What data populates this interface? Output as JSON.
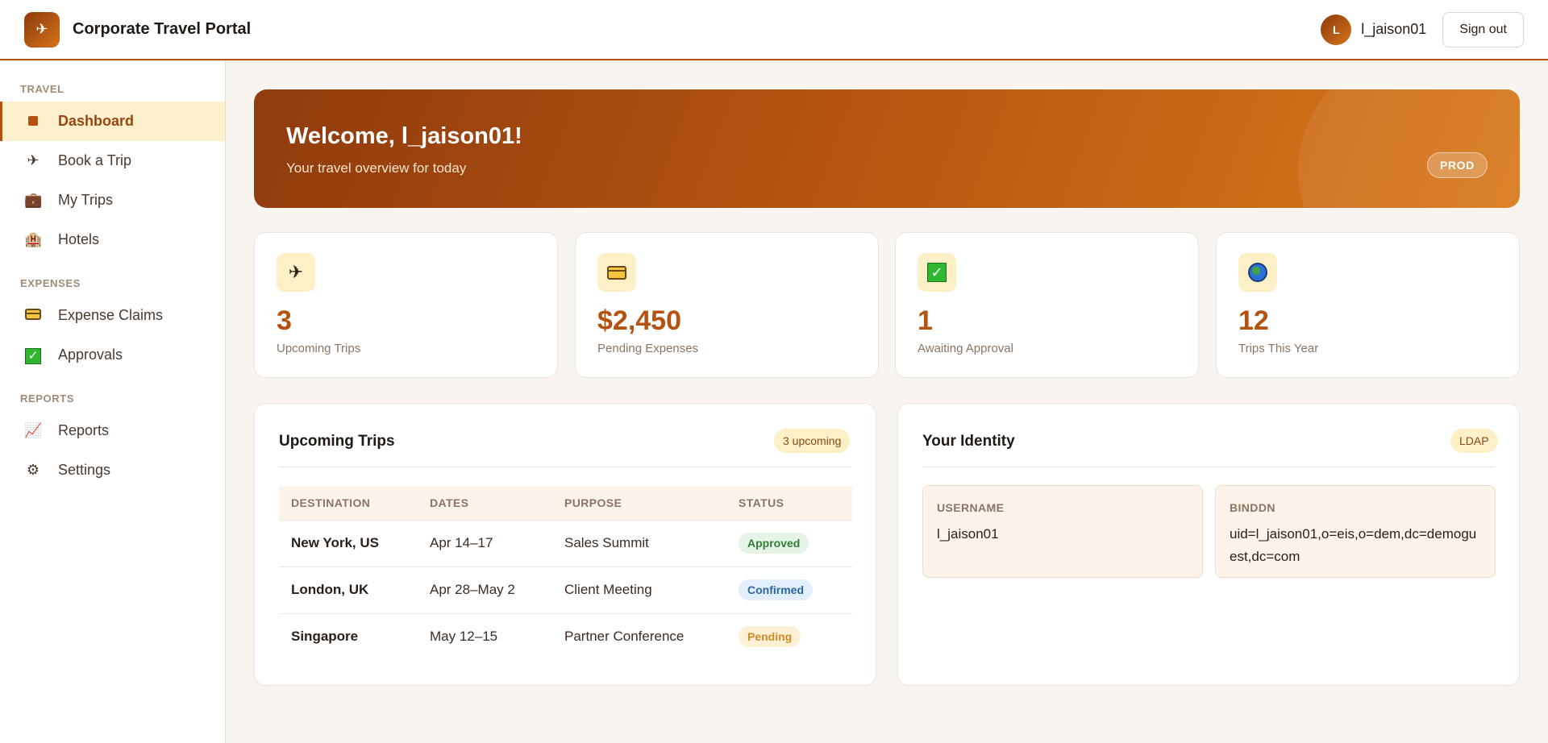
{
  "app": {
    "title": "Corporate Travel Portal",
    "logo_icon": "plane-icon"
  },
  "user": {
    "initial": "L",
    "name": "l_jaison01",
    "signout_label": "Sign out"
  },
  "sidebar": {
    "sections": [
      {
        "label": "TRAVEL",
        "items": [
          {
            "label": "Dashboard",
            "icon": "square-icon",
            "active": true
          },
          {
            "label": "Book a Trip",
            "icon": "plane-icon"
          },
          {
            "label": "My Trips",
            "icon": "briefcase-icon"
          },
          {
            "label": "Hotels",
            "icon": "hotel-icon"
          }
        ]
      },
      {
        "label": "EXPENSES",
        "items": [
          {
            "label": "Expense Claims",
            "icon": "credit-card-icon"
          },
          {
            "label": "Approvals",
            "icon": "check-icon"
          }
        ]
      },
      {
        "label": "REPORTS",
        "items": [
          {
            "label": "Reports",
            "icon": "chart-icon"
          },
          {
            "label": "Settings",
            "icon": "gear-icon"
          }
        ]
      }
    ]
  },
  "hero": {
    "title": "Welcome, l_jaison01!",
    "subtitle": "Your travel overview for today",
    "env_badge": "PROD"
  },
  "stats": [
    {
      "value": "3",
      "label": "Upcoming Trips",
      "icon": "plane-icon"
    },
    {
      "value": "$2,450",
      "label": "Pending Expenses",
      "icon": "credit-card-icon"
    },
    {
      "value": "1",
      "label": "Awaiting Approval",
      "icon": "check-icon"
    },
    {
      "value": "12",
      "label": "Trips This Year",
      "icon": "globe-icon"
    }
  ],
  "trips": {
    "title": "Upcoming Trips",
    "badge": "3 upcoming",
    "columns": [
      "DESTINATION",
      "DATES",
      "PURPOSE",
      "STATUS"
    ],
    "rows": [
      {
        "destination": "New York, US",
        "dates": "Apr 14–17",
        "purpose": "Sales Summit",
        "status": "Approved"
      },
      {
        "destination": "London, UK",
        "dates": "Apr 28–May 2",
        "purpose": "Client Meeting",
        "status": "Confirmed"
      },
      {
        "destination": "Singapore",
        "dates": "May 12–15",
        "purpose": "Partner Conference",
        "status": "Pending"
      }
    ]
  },
  "identity": {
    "title": "Your Identity",
    "badge": "LDAP",
    "username_label": "USERNAME",
    "username_value": "l_jaison01",
    "binddn_label": "BINDDN",
    "binddn_value": "uid=l_jaison01,o=eis,o=dem,dc=demoguest,dc=com"
  },
  "colors": {
    "accent": "#b5520f",
    "accent_light": "#fdf0cc",
    "approved": "#2f7d35",
    "confirmed": "#2b67a8",
    "pending": "#d18a24"
  }
}
